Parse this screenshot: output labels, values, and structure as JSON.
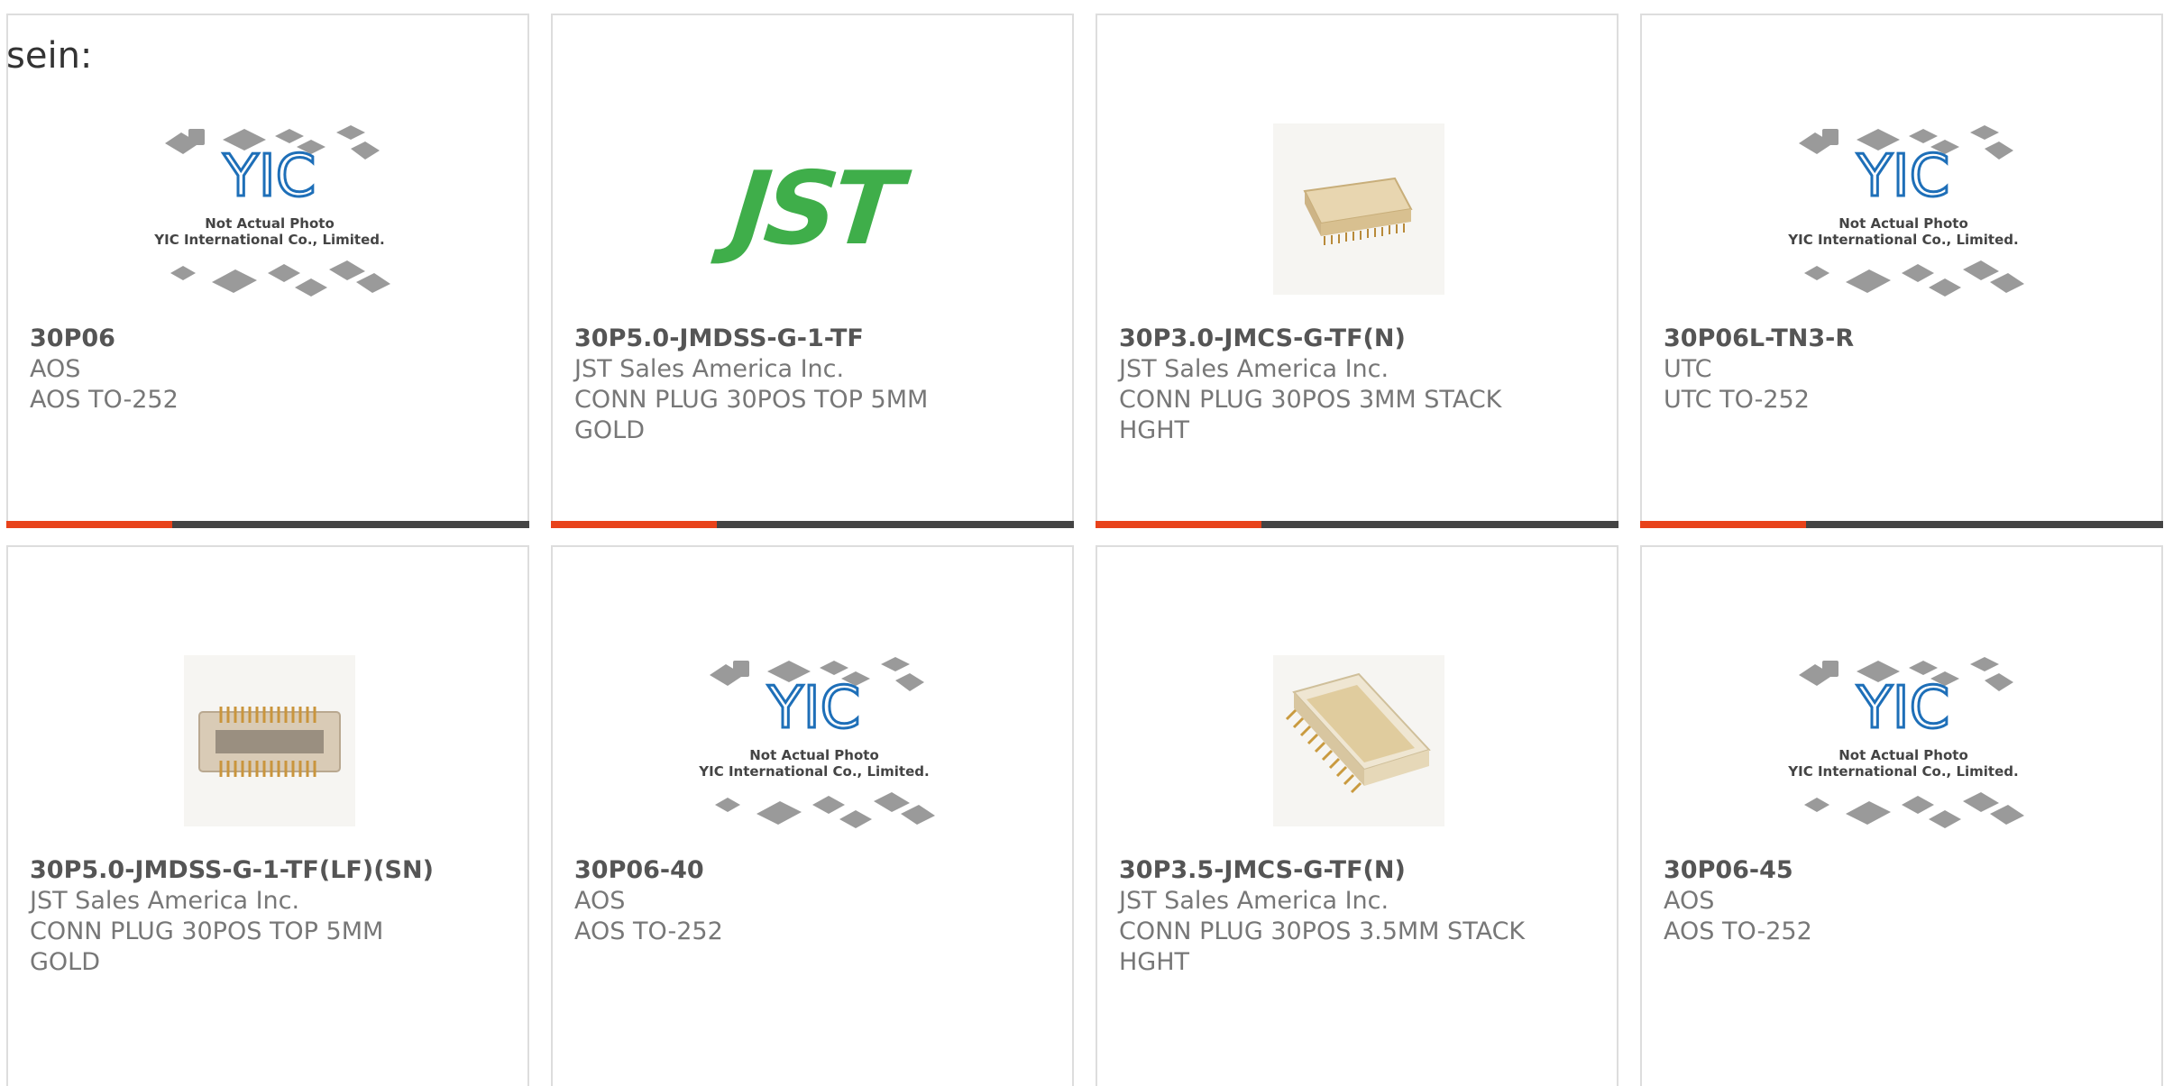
{
  "page": {
    "prefix_text": "sein:"
  },
  "placeholder_image": {
    "caption_line1": "Not Actual Photo",
    "caption_line2": "YIC International Co., Limited.",
    "logo_text": "YIC"
  },
  "brand": {
    "accent_color": "#e8421a",
    "bar_color": "#444444",
    "jst_green": "#3fae4a"
  },
  "products": [
    {
      "part_number": "30P06",
      "manufacturer": "AOS",
      "description": "AOS TO-252",
      "image": "yic-placeholder"
    },
    {
      "part_number": "30P5.0-JMDSS-G-1-TF",
      "manufacturer": "JST Sales America Inc.",
      "description": "CONN PLUG 30POS TOP 5MM\nGOLD",
      "image": "jst-logo",
      "logo_text": "JST"
    },
    {
      "part_number": "30P3.0-JMCS-G-TF(N)",
      "manufacturer": "JST Sales America Inc.",
      "description": "CONN PLUG 30POS 3MM STACK\nHGHT",
      "image": "connector-photo"
    },
    {
      "part_number": "30P06L-TN3-R",
      "manufacturer": "UTC",
      "description": "UTC TO-252",
      "image": "yic-placeholder"
    },
    {
      "part_number": "30P5.0-JMDSS-G-1-TF(LF)(SN)",
      "manufacturer": "JST Sales America Inc.",
      "description": "CONN PLUG 30POS TOP 5MM\nGOLD",
      "image": "connector-photo"
    },
    {
      "part_number": "30P06-40",
      "manufacturer": "AOS",
      "description": "AOS TO-252",
      "image": "yic-placeholder"
    },
    {
      "part_number": "30P3.5-JMCS-G-TF(N)",
      "manufacturer": "JST Sales America Inc.",
      "description": "CONN PLUG 30POS 3.5MM STACK\nHGHT",
      "image": "connector-photo"
    },
    {
      "part_number": "30P06-45",
      "manufacturer": "AOS",
      "description": "AOS TO-252",
      "image": "yic-placeholder"
    }
  ]
}
